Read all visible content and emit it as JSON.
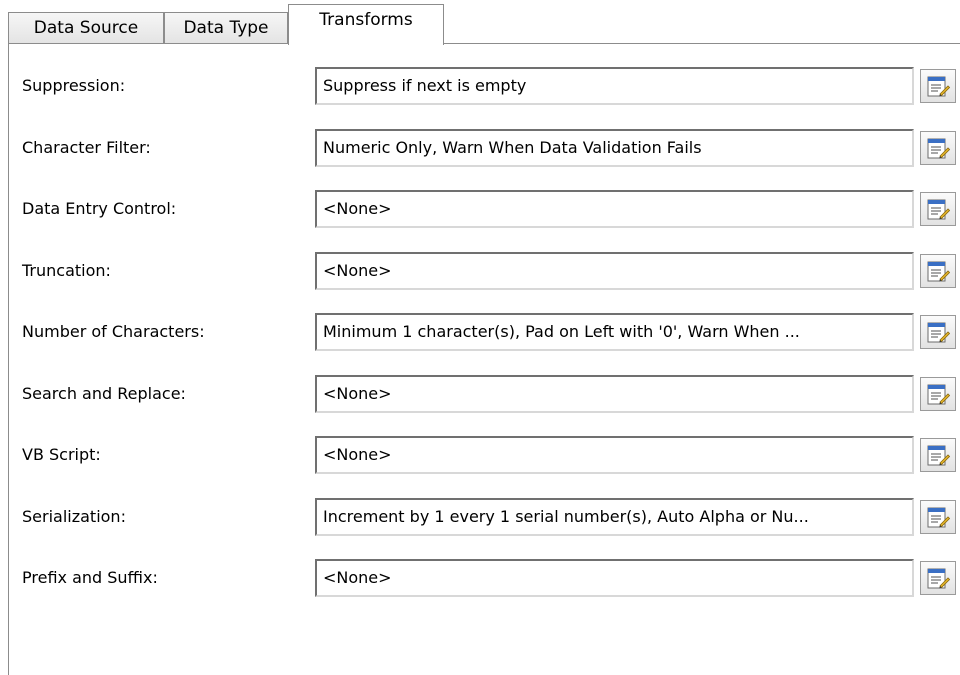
{
  "tabs": [
    {
      "label": "Data Source",
      "active": false
    },
    {
      "label": "Data Type",
      "active": false
    },
    {
      "label": "Transforms",
      "active": true
    }
  ],
  "rows": [
    {
      "label": "Suppression:",
      "value": "Suppress if next is empty"
    },
    {
      "label": "Character Filter:",
      "value": "Numeric Only, Warn When Data Validation Fails"
    },
    {
      "label": "Data Entry Control:",
      "value": "<None>"
    },
    {
      "label": "Truncation:",
      "value": "<None>"
    },
    {
      "label": "Number of Characters:",
      "value": "Minimum 1 character(s), Pad on Left with '0', Warn When ..."
    },
    {
      "label": "Search and Replace:",
      "value": "<None>"
    },
    {
      "label": "VB Script:",
      "value": "<None>"
    },
    {
      "label": "Serialization:",
      "value": "Increment by 1 every 1 serial number(s), Auto Alpha or Nu..."
    },
    {
      "label": "Prefix and Suffix:",
      "value": "<None>"
    }
  ],
  "icons": {
    "edit_button_icon": "properties-sheet-icon"
  },
  "colors": {
    "border": "#8c8c8c",
    "field_border_dark": "#707070",
    "field_border_light": "#d8d8d8"
  }
}
